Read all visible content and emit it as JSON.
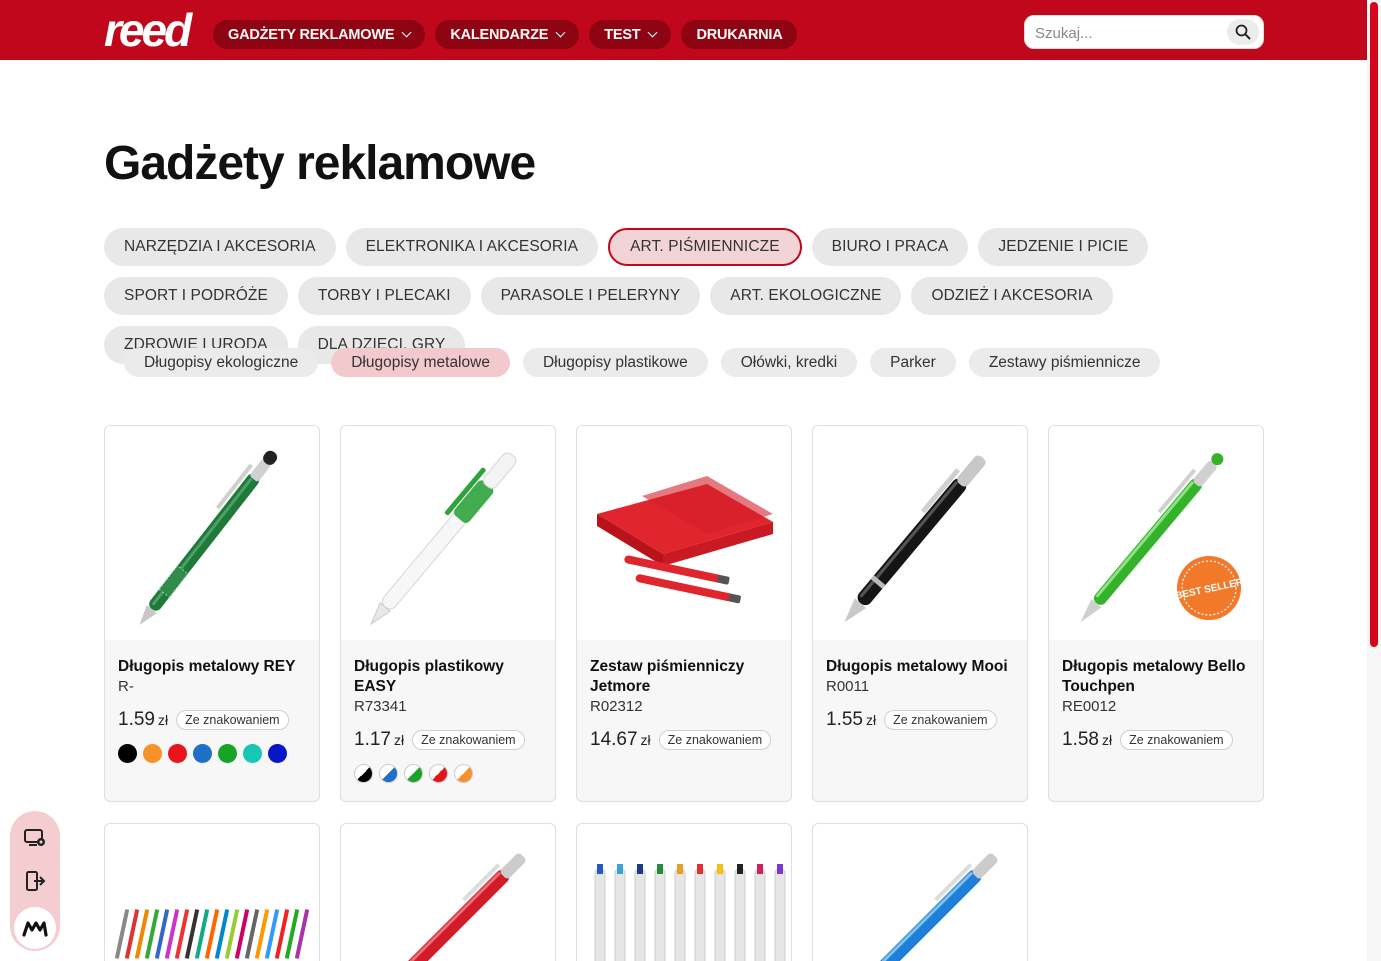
{
  "brand": {
    "logo_text": "reed"
  },
  "nav": [
    {
      "label": "GADŻETY REKLAMOWE",
      "has_dropdown": true
    },
    {
      "label": "KALENDARZE",
      "has_dropdown": true
    },
    {
      "label": "TEST",
      "has_dropdown": true
    },
    {
      "label": "DRUKARNIA",
      "has_dropdown": false
    }
  ],
  "search": {
    "placeholder": "Szukaj..."
  },
  "page_title": "Gadżety reklamowe",
  "categories": [
    {
      "label": "NARZĘDZIA I AKCESORIA",
      "active": false
    },
    {
      "label": "ELEKTRONIKA I AKCESORIA",
      "active": false
    },
    {
      "label": "ART. PIŚMIENNICZE",
      "active": true
    },
    {
      "label": "BIURO I PRACA",
      "active": false
    },
    {
      "label": "JEDZENIE I PICIE",
      "active": false
    },
    {
      "label": "SPORT I PODRÓŻE",
      "active": false
    },
    {
      "label": "TORBY I PLECAKI",
      "active": false
    },
    {
      "label": "PARASOLE I PELERYNY",
      "active": false
    },
    {
      "label": "ART. EKOLOGICZNE",
      "active": false
    },
    {
      "label": "ODZIEŻ I AKCESORIA",
      "active": false
    },
    {
      "label": "ZDROWIE I URODA",
      "active": false
    },
    {
      "label": "DLA DZIECI, GRY",
      "active": false
    }
  ],
  "subcategories": [
    {
      "label": "Długopisy ekologiczne",
      "active": false
    },
    {
      "label": "Długopisy metalowe",
      "active": true
    },
    {
      "label": "Długopisy plastikowe",
      "active": false
    },
    {
      "label": "Ołówki, kredki",
      "active": false
    },
    {
      "label": "Parker",
      "active": false
    },
    {
      "label": "Zestawy piśmiennicze",
      "active": false
    }
  ],
  "products": [
    {
      "name": "Długopis metalowy REY",
      "sku": "R-",
      "price": "1.59",
      "currency": "zł",
      "badge": "Ze znakowaniem",
      "colors": [
        "#000000",
        "#f7922a",
        "#e8141c",
        "#1e6fc7",
        "#17a327",
        "#16c7b6",
        "#0a14c8"
      ]
    },
    {
      "name": "Długopis plastikowy EASY",
      "sku": "R73341",
      "price": "1.17",
      "currency": "zł",
      "badge": "Ze znakowaniem",
      "colors": [
        "#000000",
        "#1e6fc7",
        "#17a327",
        "#e8141c",
        "#f7922a"
      ]
    },
    {
      "name": "Zestaw piśmienniczy Jetmore",
      "sku": "R02312",
      "price": "14.67",
      "currency": "zł",
      "badge": "Ze znakowaniem",
      "colors": []
    },
    {
      "name": "Długopis metalowy Mooi",
      "sku": "R0011",
      "price": "1.55",
      "currency": "zł",
      "badge": "Ze znakowaniem",
      "colors": []
    },
    {
      "name": "Długopis metalowy Bello Touchpen",
      "sku": "RE0012",
      "price": "1.58",
      "currency": "zł",
      "badge": "Ze znakowaniem",
      "colors": [],
      "sticker": "BEST SELLER"
    }
  ],
  "icons": {
    "search": "search-icon",
    "widget_settings": "screen-settings-icon",
    "widget_exit": "exit-icon",
    "widget_logo": "m-logo-icon"
  },
  "colors": {
    "brand_red": "#c1071b",
    "nav_pill": "#8e0413",
    "active_chip_bg": "#f2d4d7"
  }
}
